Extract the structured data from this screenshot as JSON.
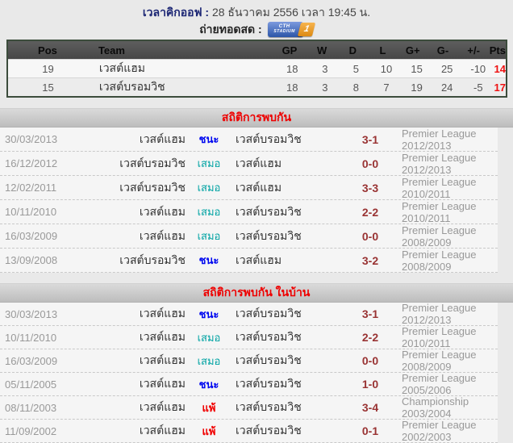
{
  "header": {
    "kickoff_label": "เวลาคิกออฟ :",
    "kickoff_value": "28 ธันวาคม 2556 เวลา 19:45 น.",
    "broadcast_label": "ถ่ายทอดสด :",
    "broadcast_badge": {
      "line1": "CTH",
      "line2": "STADIUM",
      "number": "1"
    }
  },
  "standings": {
    "columns": [
      "Pos",
      "Team",
      "GP",
      "W",
      "D",
      "L",
      "G+",
      "G-",
      "+/-",
      "Pts"
    ],
    "rows": [
      {
        "pos": "19",
        "team": "เวสต์แฮม",
        "gp": "18",
        "w": "3",
        "d": "5",
        "l": "10",
        "gplus": "15",
        "gminus": "25",
        "diff": "-10",
        "pts": "14"
      },
      {
        "pos": "15",
        "team": "เวสต์บรอมวิช",
        "gp": "18",
        "w": "3",
        "d": "8",
        "l": "7",
        "gplus": "19",
        "gminus": "24",
        "diff": "-5",
        "pts": "17"
      }
    ]
  },
  "sections": [
    {
      "title": "สถิติการพบกัน",
      "matches": [
        {
          "date": "30/03/2013",
          "home": "เวสต์แฮม",
          "result": "ชนะ",
          "result_type": "win",
          "away": "เวสต์บรอมวิช",
          "score": "3-1",
          "league": "Premier League 2012/2013"
        },
        {
          "date": "16/12/2012",
          "home": "เวสต์บรอมวิช",
          "result": "เสมอ",
          "result_type": "draw",
          "away": "เวสต์แฮม",
          "score": "0-0",
          "league": "Premier League 2012/2013"
        },
        {
          "date": "12/02/2011",
          "home": "เวสต์บรอมวิช",
          "result": "เสมอ",
          "result_type": "draw",
          "away": "เวสต์แฮม",
          "score": "3-3",
          "league": "Premier League 2010/2011"
        },
        {
          "date": "10/11/2010",
          "home": "เวสต์แฮม",
          "result": "เสมอ",
          "result_type": "draw",
          "away": "เวสต์บรอมวิช",
          "score": "2-2",
          "league": "Premier League 2010/2011"
        },
        {
          "date": "16/03/2009",
          "home": "เวสต์แฮม",
          "result": "เสมอ",
          "result_type": "draw",
          "away": "เวสต์บรอมวิช",
          "score": "0-0",
          "league": "Premier League 2008/2009"
        },
        {
          "date": "13/09/2008",
          "home": "เวสต์บรอมวิช",
          "result": "ชนะ",
          "result_type": "win",
          "away": "เวสต์แฮม",
          "score": "3-2",
          "league": "Premier League 2008/2009"
        }
      ]
    },
    {
      "title": "สถิติการพบกัน ในบ้าน",
      "matches": [
        {
          "date": "30/03/2013",
          "home": "เวสต์แฮม",
          "result": "ชนะ",
          "result_type": "win",
          "away": "เวสต์บรอมวิช",
          "score": "3-1",
          "league": "Premier League 2012/2013"
        },
        {
          "date": "10/11/2010",
          "home": "เวสต์แฮม",
          "result": "เสมอ",
          "result_type": "draw",
          "away": "เวสต์บรอมวิช",
          "score": "2-2",
          "league": "Premier League 2010/2011"
        },
        {
          "date": "16/03/2009",
          "home": "เวสต์แฮม",
          "result": "เสมอ",
          "result_type": "draw",
          "away": "เวสต์บรอมวิช",
          "score": "0-0",
          "league": "Premier League 2008/2009"
        },
        {
          "date": "05/11/2005",
          "home": "เวสต์แฮม",
          "result": "ชนะ",
          "result_type": "win",
          "away": "เวสต์บรอมวิช",
          "score": "1-0",
          "league": "Premier League 2005/2006"
        },
        {
          "date": "08/11/2003",
          "home": "เวสต์แฮม",
          "result": "แพ้",
          "result_type": "lose",
          "away": "เวสต์บรอมวิช",
          "score": "3-4",
          "league": "Championship 2003/2004"
        },
        {
          "date": "11/09/2002",
          "home": "เวสต์แฮม",
          "result": "แพ้",
          "result_type": "lose",
          "away": "เวสต์บรอมวิช",
          "score": "0-1",
          "league": "Premier League 2002/2003"
        }
      ]
    }
  ],
  "colors": {
    "section_title_red": "#ee0000",
    "win_blue": "#0008f0",
    "draw_teal": "#00a3a3",
    "lose_red": "#f00000",
    "score_maroon": "#993333",
    "pts_red": "#ee1111",
    "badge_blue": "#2c55a8",
    "badge_orange": "#dd8a14"
  }
}
